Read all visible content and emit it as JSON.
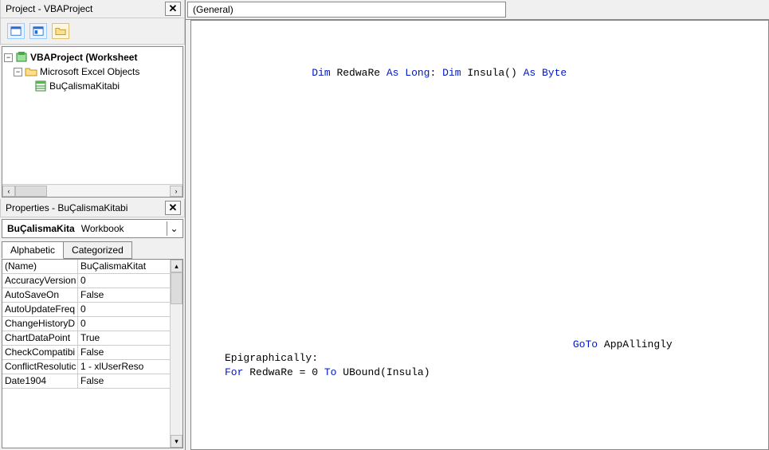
{
  "project_panel": {
    "title": "Project - VBAProject",
    "tree": {
      "root_label": "VBAProject (Worksheet",
      "objects_label": "Microsoft Excel Objects",
      "workbook_label": "BuÇalismaKitabi"
    }
  },
  "properties_panel": {
    "title": "Properties - BuÇalismaKitabi",
    "selector_name": "BuÇalismaKita",
    "selector_type": "Workbook",
    "tabs": {
      "alphabetic": "Alphabetic",
      "categorized": "Categorized"
    },
    "rows": [
      {
        "name": "(Name)",
        "value": "BuÇalismaKitat"
      },
      {
        "name": "AccuracyVersion",
        "value": "0"
      },
      {
        "name": "AutoSaveOn",
        "value": "False"
      },
      {
        "name": "AutoUpdateFreq",
        "value": "0"
      },
      {
        "name": "ChangeHistoryD",
        "value": "0"
      },
      {
        "name": "ChartDataPoint",
        "value": "True"
      },
      {
        "name": "CheckCompatibi",
        "value": "False"
      },
      {
        "name": "ConflictResolutic",
        "value": "1 - xlUserReso"
      },
      {
        "name": "Date1904",
        "value": "False"
      }
    ]
  },
  "code_area": {
    "dropdown": "(General)",
    "tokens": {
      "dim": "Dim",
      "as": "As",
      "long": "Long",
      "byte": "Byte",
      "for": "For",
      "to": "To",
      "goto": "GoTo",
      "redware": "RedwaRe",
      "insula": "Insula",
      "parens": "()",
      "colon": ":",
      "eq": " = ",
      "zero": "0",
      "ubound": "UBound",
      "lparen": "(",
      "rparen": ")",
      "appallingly": "AppAllingly",
      "label": "Epigraphically:"
    }
  }
}
